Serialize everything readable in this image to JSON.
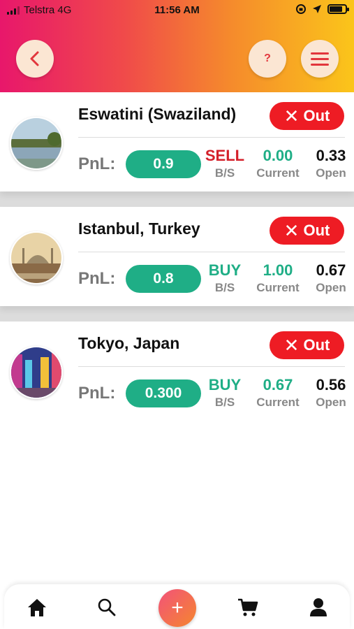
{
  "status_bar": {
    "carrier": "Telstra 4G",
    "time": "11:56 AM",
    "battery_level": 0.75
  },
  "header": {
    "back_icon": "chevron-left-icon",
    "help_label": "?",
    "menu_icon": "hamburger-icon"
  },
  "theme": {
    "gradient_start": "#e8176b",
    "gradient_end": "#fbc51a",
    "out_color": "#ee1c24",
    "pnl_color": "#1fae86",
    "sell_color": "#d4202a",
    "buy_color": "#1fae86"
  },
  "positions": [
    {
      "city": "Eswatini (Swaziland)",
      "out_label": "Out",
      "pnl_label": "PnL:",
      "pnl_value": "0.9",
      "side": "SELL",
      "side_label": "B/S",
      "current": "0.00",
      "current_label": "Current",
      "open": "0.33",
      "open_label": "Open"
    },
    {
      "city": "Istanbul, Turkey",
      "out_label": "Out",
      "pnl_label": "PnL:",
      "pnl_value": "0.8",
      "side": "BUY",
      "side_label": "B/S",
      "current": "1.00",
      "current_label": "Current",
      "open": "0.67",
      "open_label": "Open"
    },
    {
      "city": "Tokyo, Japan",
      "out_label": "Out",
      "pnl_label": "PnL:",
      "pnl_value": "0.300",
      "side": "BUY",
      "side_label": "B/S",
      "current": "0.67",
      "current_label": "Current",
      "open": "0.56",
      "open_label": "Open"
    }
  ],
  "tabbar": {
    "items": [
      "home-icon",
      "search-icon",
      "add-icon",
      "cart-icon",
      "user-icon"
    ],
    "add_label": "+"
  }
}
